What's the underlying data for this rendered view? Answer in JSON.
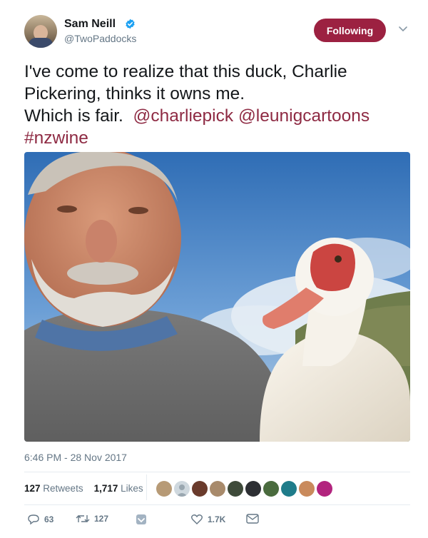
{
  "author": {
    "name": "Sam Neill",
    "handle": "@TwoPaddocks"
  },
  "follow_button": {
    "label": "Following"
  },
  "tweet": {
    "line1": "I've come to realize that this duck, Charlie",
    "line2": "Pickering, thinks it owns me.",
    "line3_text": "Which is fair.",
    "mention1": "@charliepick",
    "mention2": "@leunigcartoons",
    "hashtag": "#nzwine"
  },
  "timestamp": "6:46 PM - 28 Nov 2017",
  "stats": {
    "retweets_count": "127",
    "retweets_label": "Retweets",
    "likes_count": "1,717",
    "likes_label": "Likes"
  },
  "actions": {
    "replies": "63",
    "retweets": "127",
    "likes": "1.7K"
  },
  "colors": {
    "accent": "#9c2141",
    "link": "#8e2a43",
    "muted": "#657786"
  },
  "icons": [
    "verified-icon",
    "chevron-down-icon",
    "reply-icon",
    "retweet-icon",
    "dm-heart-icon",
    "like-icon",
    "message-icon"
  ]
}
